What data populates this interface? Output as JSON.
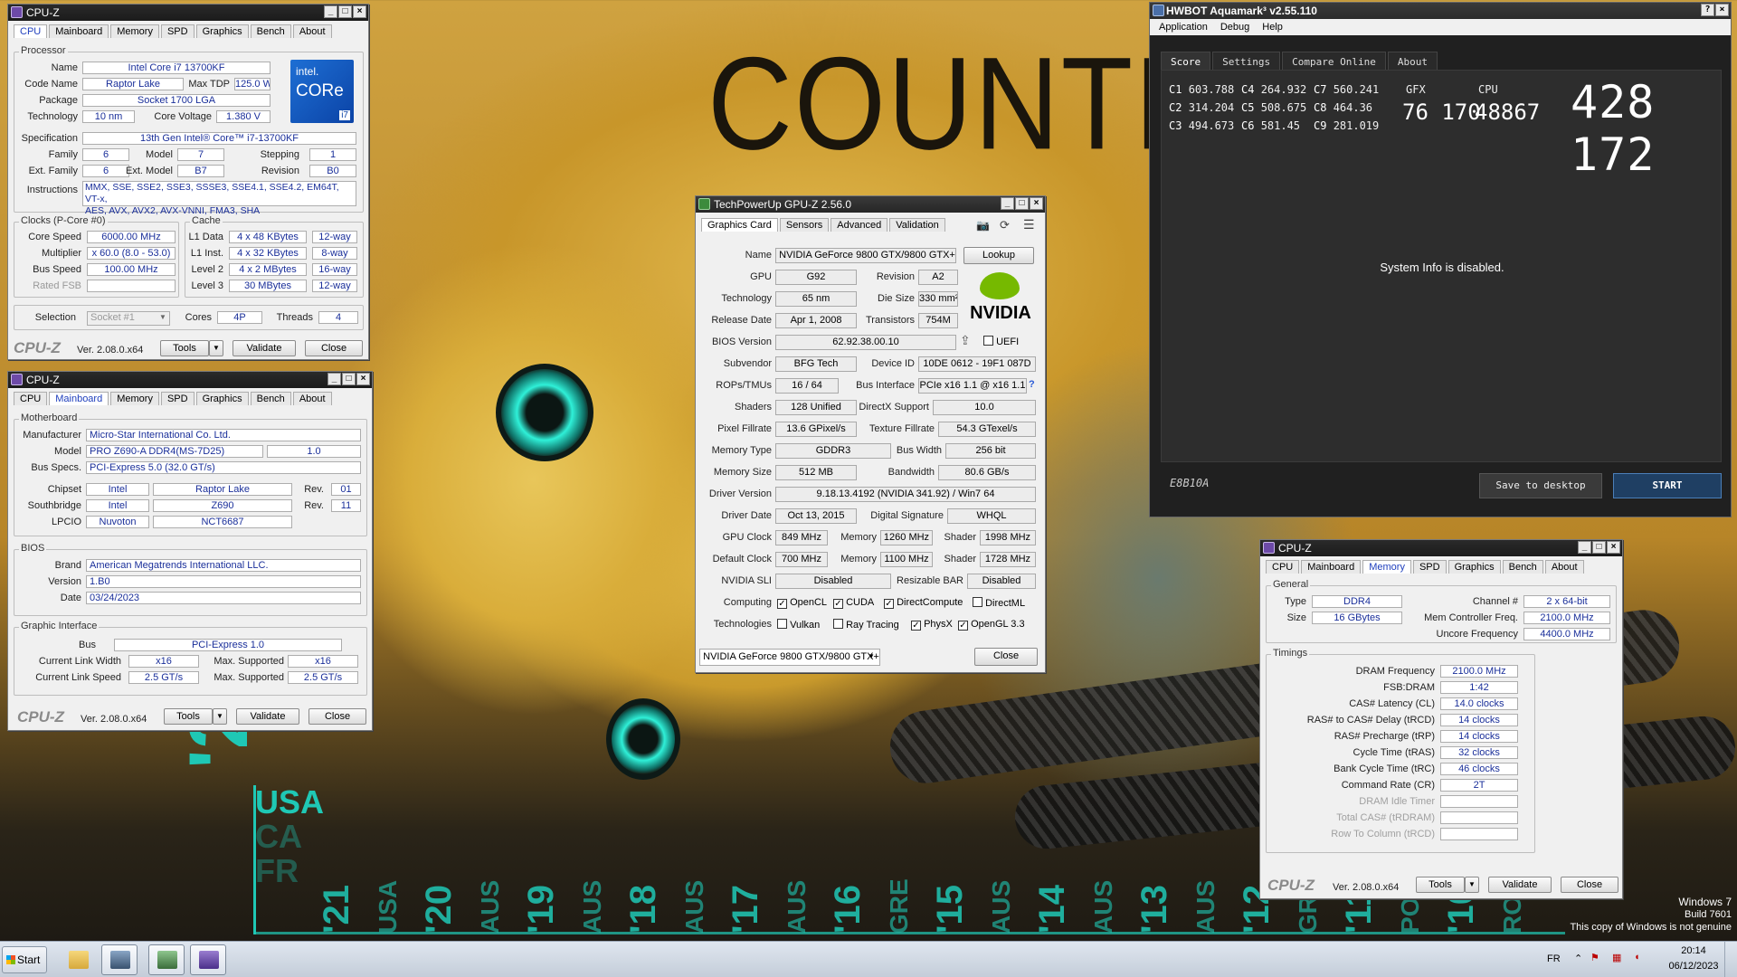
{
  "wallpaper": {
    "title": "COUNTRY",
    "year": "'22",
    "countries": [
      "USA",
      "CA",
      "FR"
    ],
    "years": [
      "'21",
      "USA",
      "'20",
      "AUS",
      "'19",
      "AUS",
      "'18",
      "AUS",
      "'17",
      "AUS",
      "'16",
      "GRE",
      "'15",
      "AUS",
      "'14",
      "AUS",
      "'13",
      "AUS",
      "'12",
      "GRE",
      "'11",
      "PO",
      "'10",
      "RO"
    ],
    "watermark": {
      "line1": "Windows 7",
      "line2": "Build 7601",
      "line3": "This copy of Windows is not genuine"
    }
  },
  "cpuz_cpu": {
    "title": "CPU-Z",
    "tabs": [
      "CPU",
      "Mainboard",
      "Memory",
      "SPD",
      "Graphics",
      "Bench",
      "About"
    ],
    "active_tab": "CPU",
    "processor": {
      "group": "Processor",
      "name_label": "Name",
      "name": "Intel Core i7 13700KF",
      "codename_label": "Code Name",
      "codename": "Raptor Lake",
      "maxtdp_label": "Max TDP",
      "maxtdp": "125.0 W",
      "package_label": "Package",
      "package": "Socket 1700 LGA",
      "tech_label": "Technology",
      "tech": "10 nm",
      "voltage_label": "Core Voltage",
      "voltage": "1.380 V",
      "spec_label": "Specification",
      "spec": "13th Gen Intel® Core™ i7-13700KF",
      "family_label": "Family",
      "family": "6",
      "model_label": "Model",
      "model": "7",
      "stepping_label": "Stepping",
      "stepping": "1",
      "extfamily_label": "Ext. Family",
      "extfamily": "6",
      "extmodel_label": "Ext. Model",
      "extmodel": "B7",
      "revision_label": "Revision",
      "revision": "B0",
      "instr_label": "Instructions",
      "instr1": "MMX, SSE, SSE2, SSE3, SSSE3, SSE4.1, SSE4.2, EM64T, VT-x,",
      "instr2": "AES, AVX, AVX2, AVX-VNNI, FMA3, SHA",
      "logo_brand": "intel.",
      "logo_core": "CORe",
      "logo_tier": "i7"
    },
    "clocks": {
      "group": "Clocks (P-Core #0)",
      "core_speed_label": "Core Speed",
      "core_speed": "6000.00 MHz",
      "multiplier_label": "Multiplier",
      "multiplier": "x 60.0 (8.0 - 53.0)",
      "bus_speed_label": "Bus Speed",
      "bus_speed": "100.00 MHz",
      "rated_fsb_label": "Rated FSB"
    },
    "cache": {
      "group": "Cache",
      "l1d_label": "L1 Data",
      "l1d": "4 x 48 KBytes",
      "l1d_way": "12-way",
      "l1i_label": "L1 Inst.",
      "l1i": "4 x 32 KBytes",
      "l1i_way": "8-way",
      "l2_label": "Level 2",
      "l2": "4 x 2 MBytes",
      "l2_way": "16-way",
      "l3_label": "Level 3",
      "l3": "30 MBytes",
      "l3_way": "12-way"
    },
    "selection_label": "Selection",
    "selection": "Socket #1",
    "cores_label": "Cores",
    "cores": "4P",
    "threads_label": "Threads",
    "threads": "4",
    "logo": "CPU-Z",
    "version": "Ver. 2.08.0.x64",
    "tools": "Tools",
    "validate": "Validate",
    "close": "Close"
  },
  "cpuz_mb": {
    "title": "CPU-Z",
    "tabs": [
      "CPU",
      "Mainboard",
      "Memory",
      "SPD",
      "Graphics",
      "Bench",
      "About"
    ],
    "active_tab": "Mainboard",
    "mb_group": "Motherboard",
    "manufacturer_label": "Manufacturer",
    "manufacturer": "Micro-Star International Co. Ltd.",
    "model_label": "Model",
    "model": "PRO Z690-A DDR4(MS-7D25)",
    "model_rev": "1.0",
    "busspecs_label": "Bus Specs.",
    "busspecs": "PCI-Express 5.0 (32.0 GT/s)",
    "chipset_label": "Chipset",
    "chipset_vendor": "Intel",
    "chipset_name": "Raptor Lake",
    "rev_label": "Rev.",
    "chipset_rev": "01",
    "south_label": "Southbridge",
    "south_vendor": "Intel",
    "south_name": "Z690",
    "south_rev": "11",
    "lpcio_label": "LPCIO",
    "lpcio_vendor": "Nuvoton",
    "lpcio_name": "NCT6687",
    "bios_group": "BIOS",
    "brand_label": "Brand",
    "brand": "American Megatrends International LLC.",
    "version_label": "Version",
    "bios_version": "1.B0",
    "date_label": "Date",
    "bios_date": "03/24/2023",
    "gi_group": "Graphic Interface",
    "bus_label": "Bus",
    "bus": "PCI-Express 1.0",
    "clw_label": "Current Link Width",
    "clw": "x16",
    "maxs_label": "Max. Supported",
    "clw_max": "x16",
    "cls_label": "Current Link Speed",
    "cls": "2.5 GT/s",
    "cls_max": "2.5 GT/s",
    "logo": "CPU-Z",
    "version": "Ver. 2.08.0.x64",
    "tools": "Tools",
    "validate": "Validate",
    "close": "Close"
  },
  "gpuz": {
    "title": "TechPowerUp GPU-Z 2.56.0",
    "tabs": [
      "Graphics Card",
      "Sensors",
      "Advanced",
      "Validation"
    ],
    "active_tab": "Graphics Card",
    "name_label": "Name",
    "name": "NVIDIA GeForce 9800 GTX/9800 GTX+",
    "lookup": "Lookup",
    "gpu_label": "GPU",
    "gpu": "G92",
    "revision_label": "Revision",
    "revision": "A2",
    "tech_label": "Technology",
    "tech": "65 nm",
    "die_label": "Die Size",
    "die": "330 mm²",
    "release_label": "Release Date",
    "release": "Apr 1, 2008",
    "trans_label": "Transistors",
    "trans": "754M",
    "bios_label": "BIOS Version",
    "bios": "62.92.38.00.10",
    "uefi_label": "UEFI",
    "subvendor_label": "Subvendor",
    "subvendor": "BFG Tech",
    "devid_label": "Device ID",
    "devid": "10DE 0612 - 19F1 087D",
    "rops_label": "ROPs/TMUs",
    "rops": "16 / 64",
    "busif_label": "Bus Interface",
    "busif": "PCIe x16 1.1 @ x16 1.1",
    "shaders_label": "Shaders",
    "shaders": "128 Unified",
    "dx_label": "DirectX Support",
    "dx": "10.0",
    "pixel_label": "Pixel Fillrate",
    "pixel": "13.6 GPixel/s",
    "tex_label": "Texture Fillrate",
    "tex": "54.3 GTexel/s",
    "memtype_label": "Memory Type",
    "memtype": "GDDR3",
    "buswidth_label": "Bus Width",
    "buswidth": "256 bit",
    "memsize_label": "Memory Size",
    "memsize": "512 MB",
    "bandwidth_label": "Bandwidth",
    "bandwidth": "80.6 GB/s",
    "driver_label": "Driver Version",
    "driver": "9.18.13.4192 (NVIDIA 341.92) / Win7 64",
    "ddate_label": "Driver Date",
    "ddate": "Oct 13, 2015",
    "dsig_label": "Digital Signature",
    "dsig": "WHQL",
    "gpuclock_label": "GPU Clock",
    "gpuclock": "849 MHz",
    "memory_label": "Memory",
    "memclock": "1260 MHz",
    "shader_label": "Shader",
    "shaderclock": "1998 MHz",
    "defclock_label": "Default Clock",
    "defclock": "700 MHz",
    "defmem": "1100 MHz",
    "defshader": "1728 MHz",
    "sli_label": "NVIDIA SLI",
    "sli": "Disabled",
    "rebar_label": "Resizable BAR",
    "rebar": "Disabled",
    "computing_label": "Computing",
    "opencl": "OpenCL",
    "cuda": "CUDA",
    "directcompute": "DirectCompute",
    "directml": "DirectML",
    "technologies_label": "Technologies",
    "vulkan": "Vulkan",
    "raytracing": "Ray Tracing",
    "physx": "PhysX",
    "opengl": "OpenGL 3.3",
    "selected_card": "NVIDIA GeForce 9800 GTX/9800 GTX+",
    "close": "Close",
    "nvidia_logo": "NVIDIA",
    "checks": {
      "uefi": false,
      "opencl": true,
      "cuda": true,
      "directcompute": true,
      "directml": false,
      "vulkan": false,
      "raytracing": false,
      "physx": true,
      "opengl": true
    }
  },
  "aquamark": {
    "title": "HWBOT Aquamark³ v2.55.110",
    "menu": [
      "Application",
      "Debug",
      "Help"
    ],
    "tabs": [
      "Score",
      "Settings",
      "Compare Online",
      "About"
    ],
    "active_tab": "Score",
    "scores": [
      {
        "k": "C1",
        "v": "603.788"
      },
      {
        "k": "C2",
        "v": "314.204"
      },
      {
        "k": "C3",
        "v": "494.673"
      },
      {
        "k": "C4",
        "v": "264.932"
      },
      {
        "k": "C5",
        "v": "508.675"
      },
      {
        "k": "C6",
        "v": "581.45"
      },
      {
        "k": "C7",
        "v": "560.241"
      },
      {
        "k": "C8",
        "v": "464.36"
      },
      {
        "k": "C9",
        "v": "281.019"
      }
    ],
    "gfx_label": "GFX",
    "gfx": "76 170",
    "cpu_label": "CPU",
    "cpu": "48867",
    "total": "428 172",
    "sysinfo": "System Info is disabled.",
    "code": "E8B10A",
    "save": "Save to desktop",
    "start": "START"
  },
  "cpuz_mem": {
    "title": "CPU-Z",
    "tabs": [
      "CPU",
      "Mainboard",
      "Memory",
      "SPD",
      "Graphics",
      "Bench",
      "About"
    ],
    "active_tab": "Memory",
    "general_group": "General",
    "type_label": "Type",
    "type": "DDR4",
    "channel_label": "Channel #",
    "channel": "2 x 64-bit",
    "size_label": "Size",
    "size": "16 GBytes",
    "mcf_label": "Mem Controller Freq.",
    "mcf": "2100.0 MHz",
    "uncore_label": "Uncore Frequency",
    "uncore": "4400.0 MHz",
    "timings_group": "Timings",
    "timings": [
      {
        "label": "DRAM Frequency",
        "value": "2100.0 MHz",
        "gray": false
      },
      {
        "label": "FSB:DRAM",
        "value": "1:42",
        "gray": false
      },
      {
        "label": "CAS# Latency (CL)",
        "value": "14.0 clocks",
        "gray": false
      },
      {
        "label": "RAS# to CAS# Delay (tRCD)",
        "value": "14 clocks",
        "gray": false
      },
      {
        "label": "RAS# Precharge (tRP)",
        "value": "14 clocks",
        "gray": false
      },
      {
        "label": "Cycle Time (tRAS)",
        "value": "32 clocks",
        "gray": false
      },
      {
        "label": "Bank Cycle Time (tRC)",
        "value": "46 clocks",
        "gray": false
      },
      {
        "label": "Command Rate (CR)",
        "value": "2T",
        "gray": false
      },
      {
        "label": "DRAM Idle Timer",
        "value": "",
        "gray": true
      },
      {
        "label": "Total CAS# (tRDRAM)",
        "value": "",
        "gray": true
      },
      {
        "label": "Row To Column (tRCD)",
        "value": "",
        "gray": true
      }
    ],
    "logo": "CPU-Z",
    "version": "Ver. 2.08.0.x64",
    "tools": "Tools",
    "validate": "Validate",
    "close": "Close"
  },
  "taskbar": {
    "start": "Start",
    "lang": "FR",
    "time": "20:14",
    "date": "06/12/2023"
  }
}
